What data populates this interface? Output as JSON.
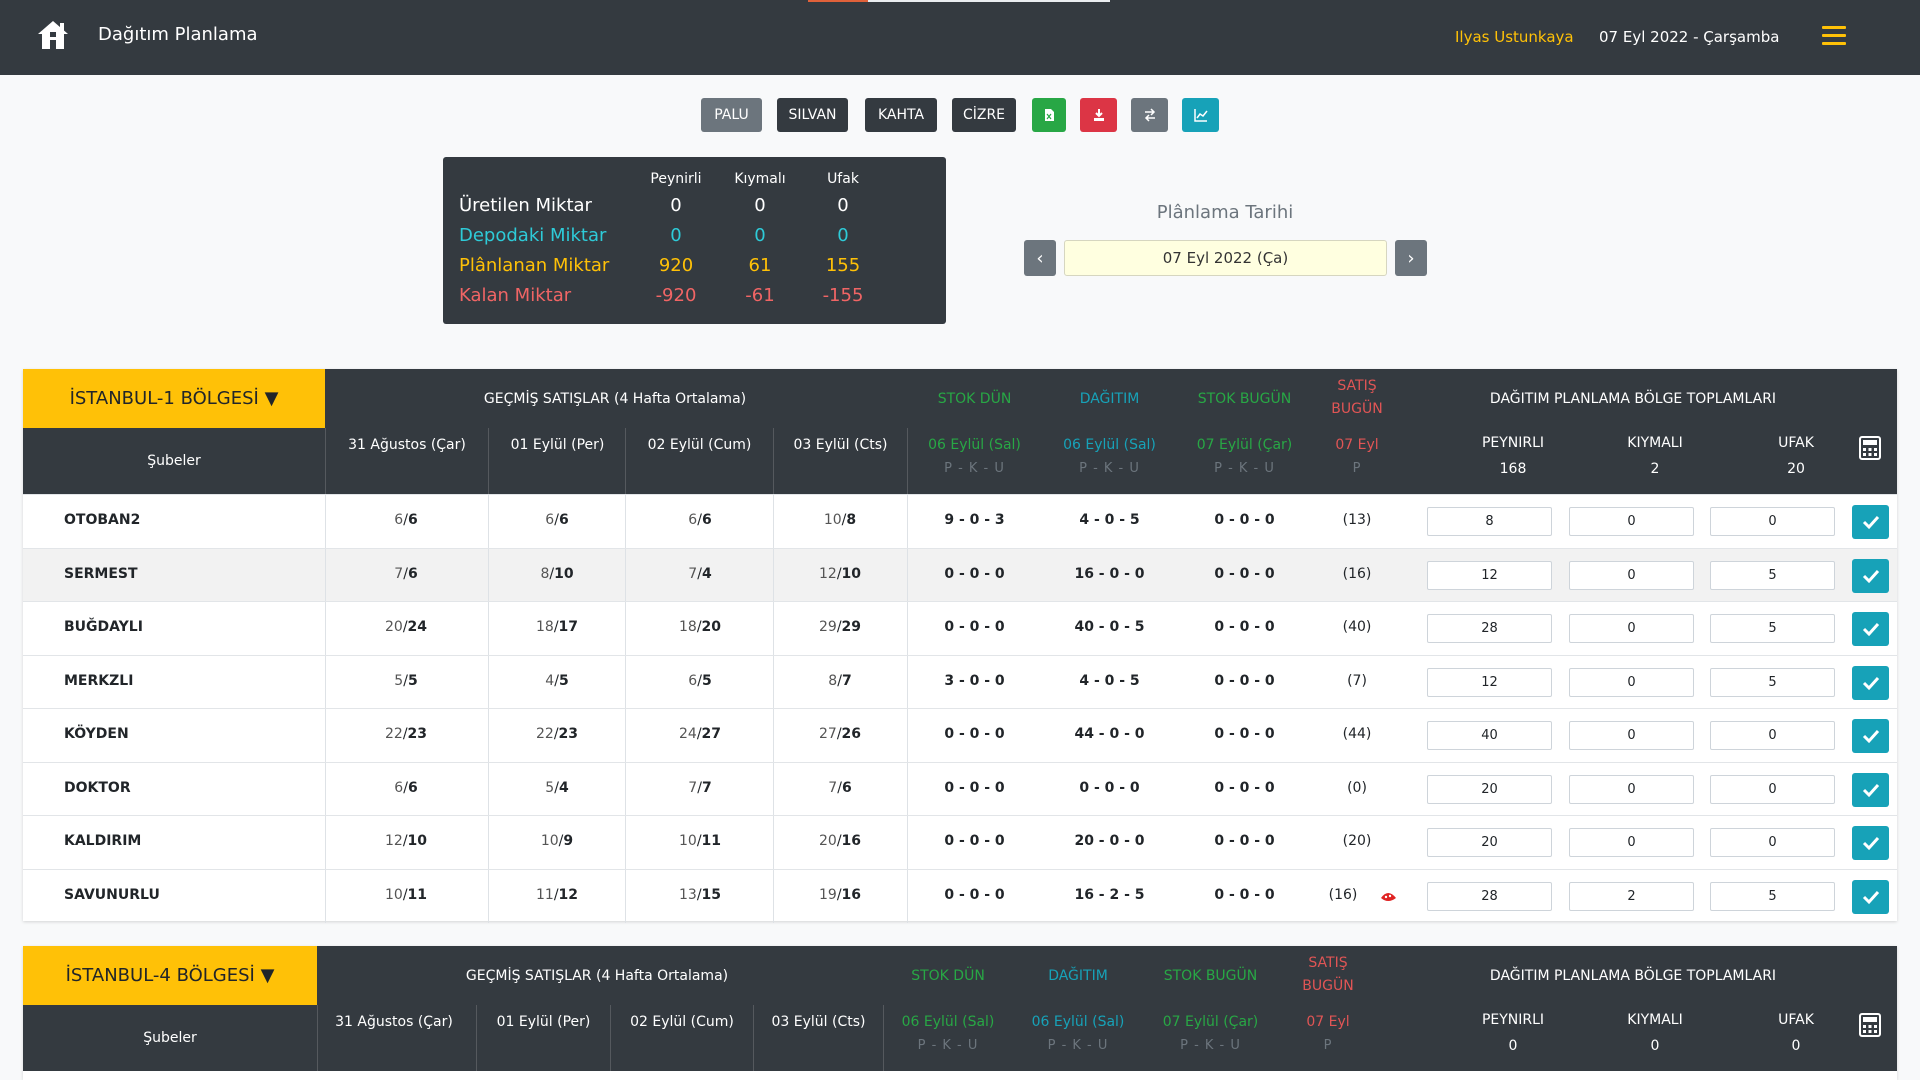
{
  "header": {
    "title": "Dağıtım Planlama",
    "user": "Ilyas Ustunkaya",
    "date": "07 Eyl 2022 - Çarşamba",
    "accent_color": "#ffc107"
  },
  "toolbar": {
    "buttons": [
      "PALU",
      "SILVAN",
      "KAHTA",
      "CİZRE"
    ],
    "icons": [
      "excel-icon",
      "download-icon",
      "transfer-icon",
      "chart-icon"
    ]
  },
  "summary": {
    "columns": [
      "Peynirli",
      "Kıymalı",
      "Ufak"
    ],
    "rows": [
      {
        "label": "Üretilen Miktar",
        "values": [
          "0",
          "0",
          "0"
        ],
        "color": "#ffffff"
      },
      {
        "label": "Depodaki Miktar",
        "values": [
          "0",
          "0",
          "0"
        ],
        "color": "#2ecbd8"
      },
      {
        "label": "Plânlanan Miktar",
        "values": [
          "920",
          "61",
          "155"
        ],
        "color": "#ffc107"
      },
      {
        "label": "Kalan Miktar",
        "values": [
          "-920",
          "-61",
          "-155"
        ],
        "color": "#f06565"
      }
    ]
  },
  "planning": {
    "label": "Plânlama Tarihi",
    "date_value": "07 Eyl 2022 (Ça)"
  },
  "regions": [
    {
      "title": "İSTANBUL-1 BÖLGESİ ▼",
      "past_sales": "GEÇMİŞ SATIŞLAR (4 Hafta Ortalama)",
      "stok_dun": "STOK DÜN",
      "dagitim": "DAĞITIM",
      "stok_bugun": "STOK BUGÜN",
      "satis_bugun_1": "SATIŞ",
      "satis_bugun_2": "BUGÜN",
      "totals_title": "DAĞITIM PLANLAMA BÖLGE TOPLAMLARI",
      "subeler": "Şubeler",
      "dates": [
        "31 Ağustos (Çar)",
        "01 Eylül (Per)",
        "02 Eylül (Cum)",
        "03 Eylül (Cts)"
      ],
      "stok_dun_date": "06 Eylül (Sal)",
      "dagitim_date": "06 Eylül (Sal)",
      "stok_bugun_date": "07 Eylül (Çar)",
      "satis_date": "07 Eyl",
      "pku": "P - K - U",
      "p": "P",
      "totals": [
        {
          "label": "PEYNIRLI",
          "value": "168"
        },
        {
          "label": "KIYMALI",
          "value": "2"
        },
        {
          "label": "UFAK",
          "value": "20"
        }
      ],
      "rows": [
        {
          "name": "OTOBAN2",
          "past": [
            [
              "6",
              "6"
            ],
            [
              "6",
              "6"
            ],
            [
              "6",
              "6"
            ],
            [
              "10",
              "8"
            ]
          ],
          "stok_dun": "9 - 0 - 3",
          "dagitim": "4 - 0 - 5",
          "stok_bugun": "0 - 0 - 0",
          "satis": "(13)",
          "inputs": [
            "8",
            "0",
            "0"
          ]
        },
        {
          "name": "SERMEST",
          "past": [
            [
              "7",
              "6"
            ],
            [
              "8",
              "10"
            ],
            [
              "7",
              "4"
            ],
            [
              "12",
              "10"
            ]
          ],
          "stok_dun": "0 - 0 - 0",
          "dagitim": "16 - 0 - 0",
          "stok_bugun": "0 - 0 - 0",
          "satis": "(16)",
          "inputs": [
            "12",
            "0",
            "5"
          ]
        },
        {
          "name": "BUĞDAYLI",
          "past": [
            [
              "20",
              "24"
            ],
            [
              "18",
              "17"
            ],
            [
              "18",
              "20"
            ],
            [
              "29",
              "29"
            ]
          ],
          "stok_dun": "0 - 0 - 0",
          "dagitim": "40 - 0 - 5",
          "stok_bugun": "0 - 0 - 0",
          "satis": "(40)",
          "inputs": [
            "28",
            "0",
            "5"
          ]
        },
        {
          "name": "MERKZLI",
          "past": [
            [
              "5",
              "5"
            ],
            [
              "4",
              "5"
            ],
            [
              "6",
              "5"
            ],
            [
              "8",
              "7"
            ]
          ],
          "stok_dun": "3 - 0 - 0",
          "dagitim": "4 - 0 - 5",
          "stok_bugun": "0 - 0 - 0",
          "satis": "(7)",
          "inputs": [
            "12",
            "0",
            "5"
          ]
        },
        {
          "name": "KÖYDEN",
          "past": [
            [
              "22",
              "23"
            ],
            [
              "22",
              "23"
            ],
            [
              "24",
              "27"
            ],
            [
              "27",
              "26"
            ]
          ],
          "stok_dun": "0 - 0 - 0",
          "dagitim": "44 - 0 - 0",
          "stok_bugun": "0 - 0 - 0",
          "satis": "(44)",
          "inputs": [
            "40",
            "0",
            "0"
          ]
        },
        {
          "name": "DOKTOR",
          "past": [
            [
              "6",
              "6"
            ],
            [
              "5",
              "4"
            ],
            [
              "7",
              "7"
            ],
            [
              "7",
              "6"
            ]
          ],
          "stok_dun": "0 - 0 - 0",
          "dagitim": "0 - 0 - 0",
          "stok_bugun": "0 - 0 - 0",
          "satis": "(0)",
          "inputs": [
            "20",
            "0",
            "0"
          ]
        },
        {
          "name": "KALDIRIM",
          "past": [
            [
              "12",
              "10"
            ],
            [
              "10",
              "9"
            ],
            [
              "10",
              "11"
            ],
            [
              "20",
              "16"
            ]
          ],
          "stok_dun": "0 - 0 - 0",
          "dagitim": "20 - 0 - 0",
          "stok_bugun": "0 - 0 - 0",
          "satis": "(20)",
          "inputs": [
            "20",
            "0",
            "0"
          ]
        },
        {
          "name": "SAVUNURLU",
          "past": [
            [
              "10",
              "11"
            ],
            [
              "11",
              "12"
            ],
            [
              "13",
              "15"
            ],
            [
              "19",
              "16"
            ]
          ],
          "stok_dun": "0 - 0 - 0",
          "dagitim": "16 - 2 - 5",
          "stok_bugun": "0 - 0 - 0",
          "satis": "(16)",
          "flag": "pizza-icon",
          "inputs": [
            "28",
            "2",
            "5"
          ]
        }
      ]
    },
    {
      "title": "İSTANBUL-4 BÖLGESİ ▼",
      "past_sales": "GEÇMİŞ SATIŞLAR (4 Hafta Ortalama)",
      "stok_dun": "STOK DÜN",
      "dagitim": "DAĞITIM",
      "stok_bugun": "STOK BUGÜN",
      "satis_bugun_1": "SATIŞ",
      "satis_bugun_2": "BUGÜN",
      "totals_title": "DAĞITIM PLANLAMA BÖLGE TOPLAMLARI",
      "subeler": "Şubeler",
      "dates": [
        "31 Ağustos (Çar)",
        "01 Eylül (Per)",
        "02 Eylül (Cum)",
        "03 Eylül (Cts)"
      ],
      "stok_dun_date": "06 Eylül (Sal)",
      "dagitim_date": "06 Eylül (Sal)",
      "stok_bugun_date": "07 Eylül (Çar)",
      "satis_date": "07 Eyl",
      "pku": "P - K - U",
      "p": "P",
      "totals": [
        {
          "label": "PEYNIRLI",
          "value": "0"
        },
        {
          "label": "KIYMALI",
          "value": "0"
        },
        {
          "label": "UFAK",
          "value": "0"
        }
      ]
    }
  ]
}
